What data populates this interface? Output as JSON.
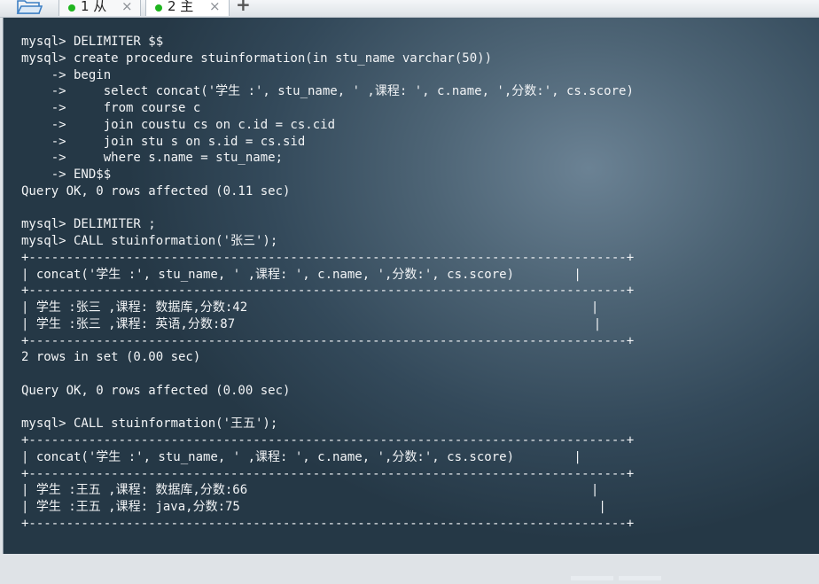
{
  "tabs": [
    {
      "label": "1 从",
      "active": false,
      "status_color": "#1fb51f"
    },
    {
      "label": "2 主",
      "active": true,
      "status_color": "#1fb51f"
    }
  ],
  "tab_close_glyph": "×",
  "new_tab_glyph": "+",
  "terminal_lines": [
    "mysql> DELIMITER $$",
    "mysql> create procedure stuinformation(in stu_name varchar(50))",
    "    -> begin",
    "    ->     select concat('学生 :', stu_name, ' ,课程: ', c.name, ',分数:', cs.score)",
    "    ->     from course c",
    "    ->     join coustu cs on c.id = cs.cid",
    "    ->     join stu s on s.id = cs.sid",
    "    ->     where s.name = stu_name;",
    "    -> END$$",
    "Query OK, 0 rows affected (0.11 sec)",
    "",
    "mysql> DELIMITER ;",
    "mysql> CALL stuinformation('张三');",
    "+--------------------------------------------------------------------------------+",
    "| concat('学生 :', stu_name, ' ,课程: ', c.name, ',分数:', cs.score)        |",
    "+--------------------------------------------------------------------------------+",
    "| 学生 :张三 ,课程: 数据库,分数:42                                              |",
    "| 学生 :张三 ,课程: 英语,分数:87                                                |",
    "+--------------------------------------------------------------------------------+",
    "2 rows in set (0.00 sec)",
    "",
    "Query OK, 0 rows affected (0.00 sec)",
    "",
    "mysql> CALL stuinformation('王五');",
    "+--------------------------------------------------------------------------------+",
    "| concat('学生 :', stu_name, ' ,课程: ', c.name, ',分数:', cs.score)        |",
    "+--------------------------------------------------------------------------------+",
    "| 学生 :王五 ,课程: 数据库,分数:66                                              |",
    "| 学生 :王五 ,课程: java,分数:75                                                |",
    "+--------------------------------------------------------------------------------+"
  ]
}
